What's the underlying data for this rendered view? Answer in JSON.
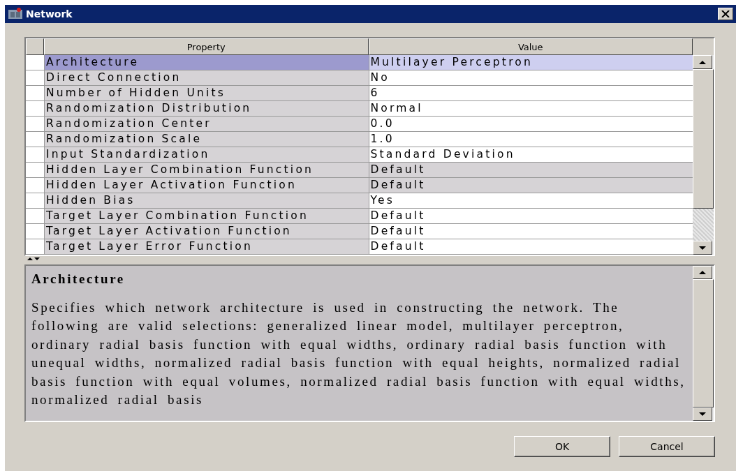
{
  "window": {
    "title": "Network"
  },
  "table": {
    "columns": [
      "Property",
      "Value"
    ],
    "rows": [
      {
        "property": "Architecture",
        "value": "Multilayer Perceptron",
        "selected": true,
        "disabled": false
      },
      {
        "property": "Direct Connection",
        "value": "No",
        "selected": false,
        "disabled": false
      },
      {
        "property": "Number of Hidden Units",
        "value": "6",
        "selected": false,
        "disabled": false
      },
      {
        "property": "Randomization Distribution",
        "value": "Normal",
        "selected": false,
        "disabled": false
      },
      {
        "property": "Randomization Center",
        "value": "0.0",
        "selected": false,
        "disabled": false
      },
      {
        "property": "Randomization Scale",
        "value": "1.0",
        "selected": false,
        "disabled": false
      },
      {
        "property": "Input Standardization",
        "value": "Standard Deviation",
        "selected": false,
        "disabled": false
      },
      {
        "property": "Hidden Layer Combination Function",
        "value": "Default",
        "selected": false,
        "disabled": true
      },
      {
        "property": "Hidden Layer Activation Function",
        "value": "Default",
        "selected": false,
        "disabled": true
      },
      {
        "property": "Hidden Bias",
        "value": "Yes",
        "selected": false,
        "disabled": false
      },
      {
        "property": "Target Layer Combination Function",
        "value": "Default",
        "selected": false,
        "disabled": false
      },
      {
        "property": "Target Layer Activation Function",
        "value": "Default",
        "selected": false,
        "disabled": false
      },
      {
        "property": "Target Layer Error Function",
        "value": "Default",
        "selected": false,
        "disabled": false
      }
    ]
  },
  "description": {
    "heading": "Architecture",
    "text": "Specifies which network architecture is used in constructing the network. The following are valid selections: generalized linear model, multilayer perceptron, ordinary radial basis function with equal widths, ordinary radial basis function with unequal widths, normalized radial basis function with equal heights, normalized radial basis function with equal volumes, normalized radial basis function with equal widths, normalized radial basis"
  },
  "buttons": [
    "OK",
    "Cancel"
  ]
}
